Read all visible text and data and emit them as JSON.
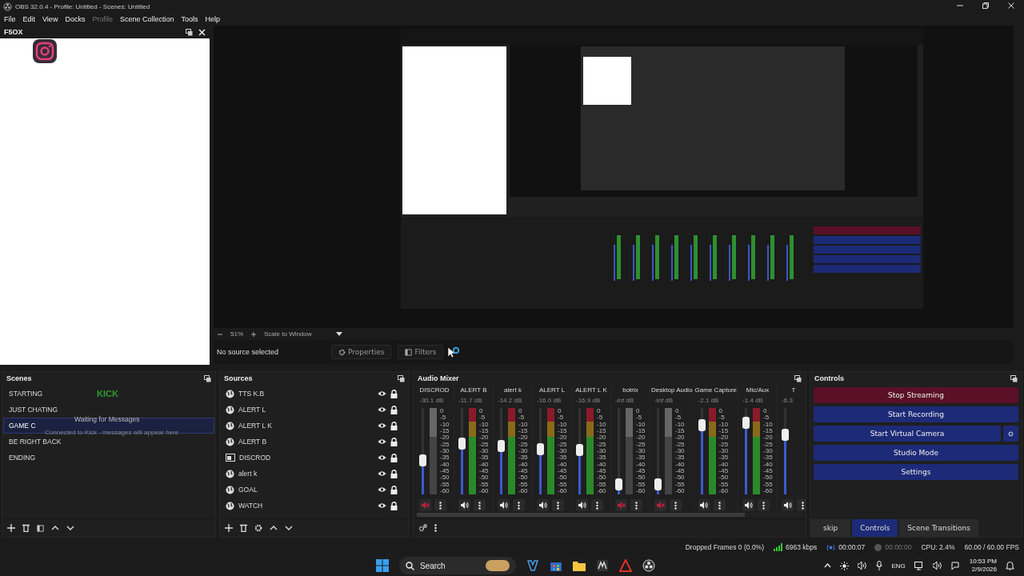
{
  "window": {
    "title": "OBS 32.0.4 - Profile: Untitled - Scenes: Untitled"
  },
  "menu": [
    {
      "label": "File",
      "disabled": false
    },
    {
      "label": "Edit",
      "disabled": false
    },
    {
      "label": "View",
      "disabled": false
    },
    {
      "label": "Docks",
      "disabled": false
    },
    {
      "label": "Profile",
      "disabled": true
    },
    {
      "label": "Scene Collection",
      "disabled": false
    },
    {
      "label": "Tools",
      "disabled": false
    },
    {
      "label": "Help",
      "disabled": false
    }
  ],
  "custom_dock": {
    "title": "F5OX"
  },
  "preview": {
    "zoom": "51%",
    "scale_mode": "Scale to Window"
  },
  "source_toolbar": {
    "status": "No source selected",
    "properties": "Properties",
    "filters": "Filters"
  },
  "scenes": {
    "title": "Scenes",
    "items": [
      {
        "label": "STARTING",
        "selected": false
      },
      {
        "label": "JUST CHATING",
        "selected": false
      },
      {
        "label": "GAME C",
        "selected": true
      },
      {
        "label": "BE RIGHT BACK",
        "selected": false
      },
      {
        "label": "ENDING",
        "selected": false
      }
    ],
    "chat_overlay": {
      "logo": "KICK",
      "heading": "Waiting for Messages",
      "message": "Connected to Kick - messages will appear here"
    }
  },
  "sources": {
    "title": "Sources",
    "items": [
      {
        "label": "TTS K.B",
        "kind": "browser"
      },
      {
        "label": "ALERT L",
        "kind": "browser"
      },
      {
        "label": "ALERT L K",
        "kind": "browser"
      },
      {
        "label": "ALERT B",
        "kind": "browser"
      },
      {
        "label": "DISCROD",
        "kind": "window"
      },
      {
        "label": "alert k",
        "kind": "browser"
      },
      {
        "label": "GOAL",
        "kind": "browser"
      },
      {
        "label": "WATCH",
        "kind": "browser"
      }
    ]
  },
  "audio_mixer": {
    "title": "Audio Mixer",
    "channels": [
      {
        "name": "DISCROD",
        "reading": "-30.1 dB",
        "level": 0.38,
        "muted": true,
        "scale": [
          "0",
          "-5",
          "-10",
          "-15",
          "-20",
          "-25",
          "-30",
          "-35",
          "-40",
          "-45",
          "-50",
          "-55",
          "-60"
        ]
      },
      {
        "name": "ALERT B",
        "reading": "-11.7 dB",
        "level": 0.6,
        "muted": false,
        "scale": [
          "0",
          "-5",
          "-10",
          "-15",
          "-20",
          "-25",
          "-30",
          "-35",
          "-40",
          "-45",
          "-50",
          "-55",
          "-60"
        ]
      },
      {
        "name": "alert k",
        "reading": "-14.2 dB",
        "level": 0.57,
        "muted": false,
        "scale": [
          "0",
          "-5",
          "-10",
          "-15",
          "-20",
          "-25",
          "-30",
          "-35",
          "-40",
          "-45",
          "-50",
          "-55",
          "-60"
        ]
      },
      {
        "name": "ALERT L",
        "reading": "-16.0 dB",
        "level": 0.53,
        "muted": false,
        "scale": [
          "0",
          "-5",
          "-10",
          "-15",
          "-20",
          "-25",
          "-30",
          "-35",
          "-40",
          "-45",
          "-50",
          "-55",
          "-60"
        ]
      },
      {
        "name": "ALERT L K",
        "reading": "-16.9 dB",
        "level": 0.52,
        "muted": false,
        "scale": [
          "0",
          "-5",
          "-10",
          "-15",
          "-20",
          "-25",
          "-30",
          "-35",
          "-40",
          "-45",
          "-50",
          "-55",
          "-60"
        ]
      },
      {
        "name": "botrix",
        "reading": "-inf dB",
        "level": 0.05,
        "muted": true,
        "scale": [
          "0",
          "-5",
          "-10",
          "-15",
          "-20",
          "-25",
          "-30",
          "-35",
          "-40",
          "-45",
          "-50",
          "-55",
          "-60"
        ]
      },
      {
        "name": "Desktop Audio",
        "reading": "-inf dB",
        "level": 0.05,
        "muted": true,
        "scale": [
          "0",
          "-5",
          "-10",
          "-15",
          "-20",
          "-25",
          "-30",
          "-35",
          "-40",
          "-45",
          "-50",
          "-55",
          "-60"
        ]
      },
      {
        "name": "Game Capture",
        "reading": "-2.1 dB",
        "level": 0.85,
        "muted": false,
        "scale": [
          "0",
          "-5",
          "-10",
          "-15",
          "-20",
          "-25",
          "-30",
          "-35",
          "-40",
          "-45",
          "-50",
          "-55",
          "-60"
        ]
      },
      {
        "name": "Mic/Aux",
        "reading": "-1.4 dB",
        "level": 0.88,
        "muted": false,
        "scale": [
          "0",
          "-5",
          "-10",
          "-15",
          "-20",
          "-25",
          "-30",
          "-35",
          "-40",
          "-45",
          "-50",
          "-55",
          "-60"
        ]
      },
      {
        "name": "T",
        "reading": "-6.3",
        "level": 0.72,
        "muted": false
      }
    ]
  },
  "controls": {
    "title": "Controls",
    "buttons": [
      {
        "label": "Stop Streaming",
        "kind": "active",
        "has_settings": false
      },
      {
        "label": "Start Recording",
        "kind": "normal",
        "has_settings": false
      },
      {
        "label": "Start Virtual Camera",
        "kind": "normal",
        "has_settings": true
      },
      {
        "label": "Studio Mode",
        "kind": "normal",
        "has_settings": false
      },
      {
        "label": "Settings",
        "kind": "normal",
        "has_settings": false
      }
    ]
  },
  "dock_tabs": [
    {
      "label": "skip",
      "selected": false
    },
    {
      "label": "Controls",
      "selected": true
    },
    {
      "label": "Scene Transitions",
      "selected": false
    }
  ],
  "status_bar": {
    "dropped_frames": "Dropped Frames 0 (0.0%)",
    "bitrate": "6963 kbps",
    "stream_time": "00:00:07",
    "record_time": "00:00:00",
    "recording": false,
    "cpu": "CPU: 2.4%",
    "fps": "60.00 / 60.00 FPS"
  },
  "taskbar": {
    "search_placeholder": "Search",
    "language": "ENG",
    "time": "10:53 PM",
    "date": "2/9/2026"
  }
}
